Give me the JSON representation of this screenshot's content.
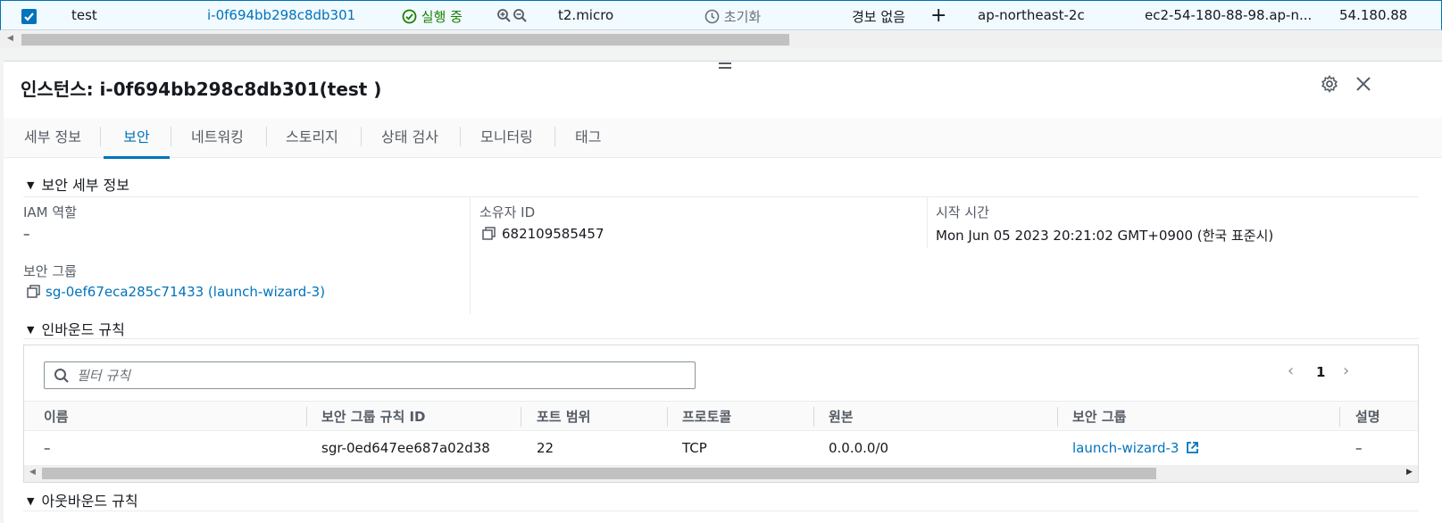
{
  "row": {
    "name": "test",
    "instance_id": "i-0f694bb298c8db301",
    "state": "실행 중",
    "instance_type": "t2.micro",
    "status_check": "초기화",
    "alarm": "경보 없음",
    "az": "ap-northeast-2c",
    "public_dns": "ec2-54-180-88-98.ap-n...",
    "public_ip": "54.180.88"
  },
  "panel": {
    "title": "인스턴스: i-0f694bb298c8db301(test )"
  },
  "tabs": [
    {
      "label": "세부 정보"
    },
    {
      "label": "보안"
    },
    {
      "label": "네트워킹"
    },
    {
      "label": "스토리지"
    },
    {
      "label": "상태 검사"
    },
    {
      "label": "모니터링"
    },
    {
      "label": "태그"
    }
  ],
  "security_details": {
    "heading": "보안 세부 정보",
    "iam_label": "IAM 역할",
    "iam_value": "–",
    "owner_label": "소유자 ID",
    "owner_value": "682109585457",
    "launch_label": "시작 시간",
    "launch_value": "Mon Jun 05 2023 20:21:02 GMT+0900 (한국 표준시)",
    "sg_label": "보안 그룹",
    "sg_value": "sg-0ef67eca285c71433 (launch-wizard-3)"
  },
  "inbound": {
    "heading": "인바운드 규칙",
    "filter_placeholder": "필터 규칙",
    "page": "1",
    "columns": [
      "이름",
      "보안 그룹 규칙 ID",
      "포트 범위",
      "프로토콜",
      "원본",
      "보안 그룹",
      "설명"
    ],
    "rows": [
      {
        "name": "–",
        "rule_id": "sgr-0ed647ee687a02d38",
        "port": "22",
        "protocol": "TCP",
        "source": "0.0.0.0/0",
        "sg": "launch-wizard-3",
        "desc": "–"
      }
    ]
  },
  "outbound": {
    "heading": "아웃바운드 규칙"
  },
  "colors": {
    "accent": "#0073bb",
    "running": "#1d8102"
  }
}
